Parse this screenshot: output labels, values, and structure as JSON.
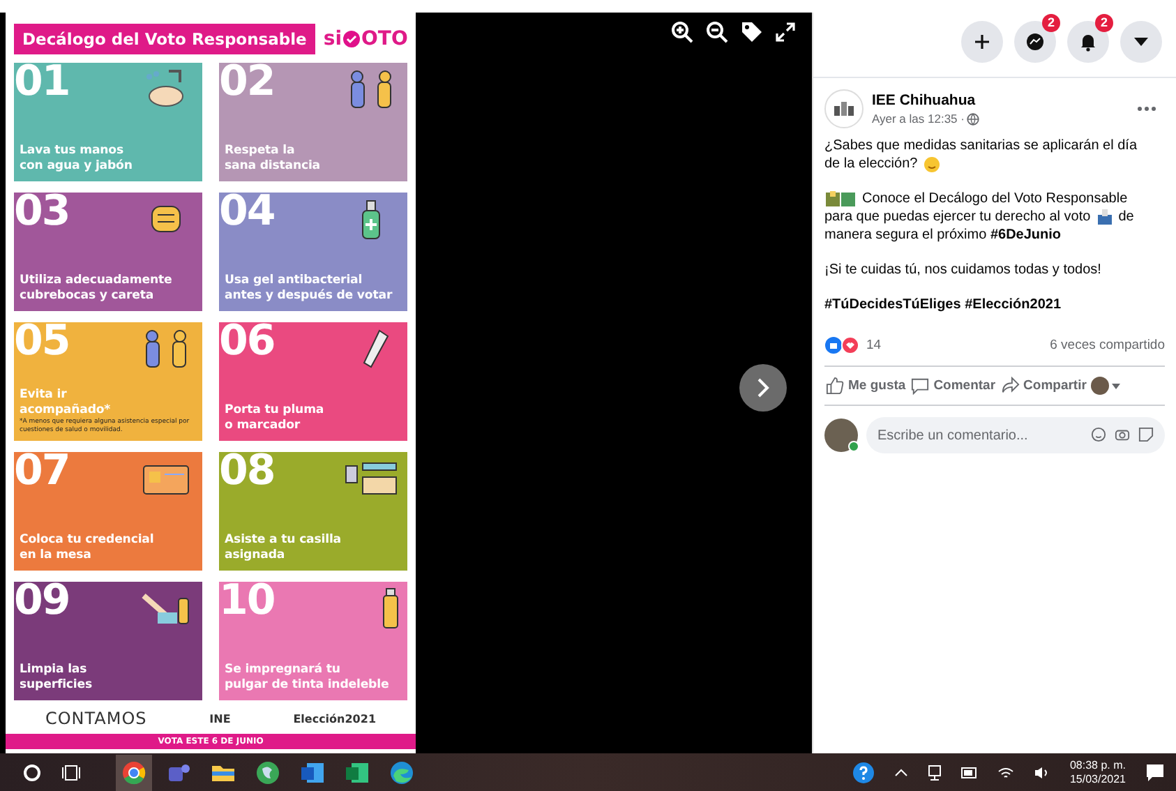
{
  "viewer": {
    "poster": {
      "title": "Decálogo del Voto Responsable",
      "logo": [
        "si",
        "OTO"
      ],
      "tiles": [
        {
          "number": "01",
          "lines": [
            "Lava tus manos",
            "con agua y jabón"
          ],
          "color": "#5fb8ad"
        },
        {
          "number": "02",
          "lines": [
            "Respeta la",
            "sana distancia"
          ],
          "color": "#b596b4"
        },
        {
          "number": "03",
          "lines": [
            "Utiliza adecuadamente",
            "cubrebocas y careta"
          ],
          "color": "#a1579a"
        },
        {
          "number": "04",
          "lines": [
            "Usa gel antibacterial",
            "antes y después de votar"
          ],
          "color": "#8a8cc6"
        },
        {
          "number": "05",
          "lines": [
            "Evita ir",
            "acompañado*"
          ],
          "note": "*A menos que requiera alguna asistencia especial por cuestiones de salud o movilidad.",
          "color": "#f0b23e"
        },
        {
          "number": "06",
          "lines": [
            "Porta tu pluma",
            "o marcador"
          ],
          "color": "#ea4a80"
        },
        {
          "number": "07",
          "lines": [
            "Coloca tu credencial",
            "en la mesa"
          ],
          "color": "#ec7a3e"
        },
        {
          "number": "08",
          "lines": [
            "Asiste a tu casilla",
            "asignada"
          ],
          "color": "#9aab2b"
        },
        {
          "number": "09",
          "lines": [
            "Limpia las",
            "superficies"
          ],
          "color": "#7b3b7a"
        },
        {
          "number": "10",
          "lines": [
            "Se impregnará tu",
            "pulgar de tinta indeleble"
          ],
          "color": "#ea78b2"
        }
      ],
      "footer": {
        "brand": "CONTAMOS",
        "logos": [
          "INE",
          "Elección2021"
        ]
      },
      "banner": "VOTA ESTE 6 DE JUNIO"
    }
  },
  "topbar": {
    "badges": [
      "2",
      "2"
    ]
  },
  "post": {
    "author": "IEE Chihuahua",
    "time": "Ayer a las 12:35 ·",
    "paragraph_1": [
      "¿Sabes que medidas sanitarias se aplicarán el día",
      "de la elección?"
    ],
    "paragraph_2": [
      "Conoce el Decálogo del Voto Responsable",
      "para que puedas ejercer tu derecho al voto",
      "de",
      "manera segura el próximo **#6DeJunio**"
    ],
    "paragraph_3": "¡Si te cuidas tú, nos cuidamos todas y todos!",
    "hashtags": "#TúDecidesTúEliges #Elección2021",
    "reactions": "14",
    "shares": "6 veces compartido",
    "actions": [
      "Me gusta",
      "Comentar",
      "Compartir"
    ],
    "comment": {
      "placeholder": "Escribe un comentario..."
    }
  },
  "taskbar": {
    "time": "08:38 p. m.",
    "date": "15/03/2021"
  }
}
